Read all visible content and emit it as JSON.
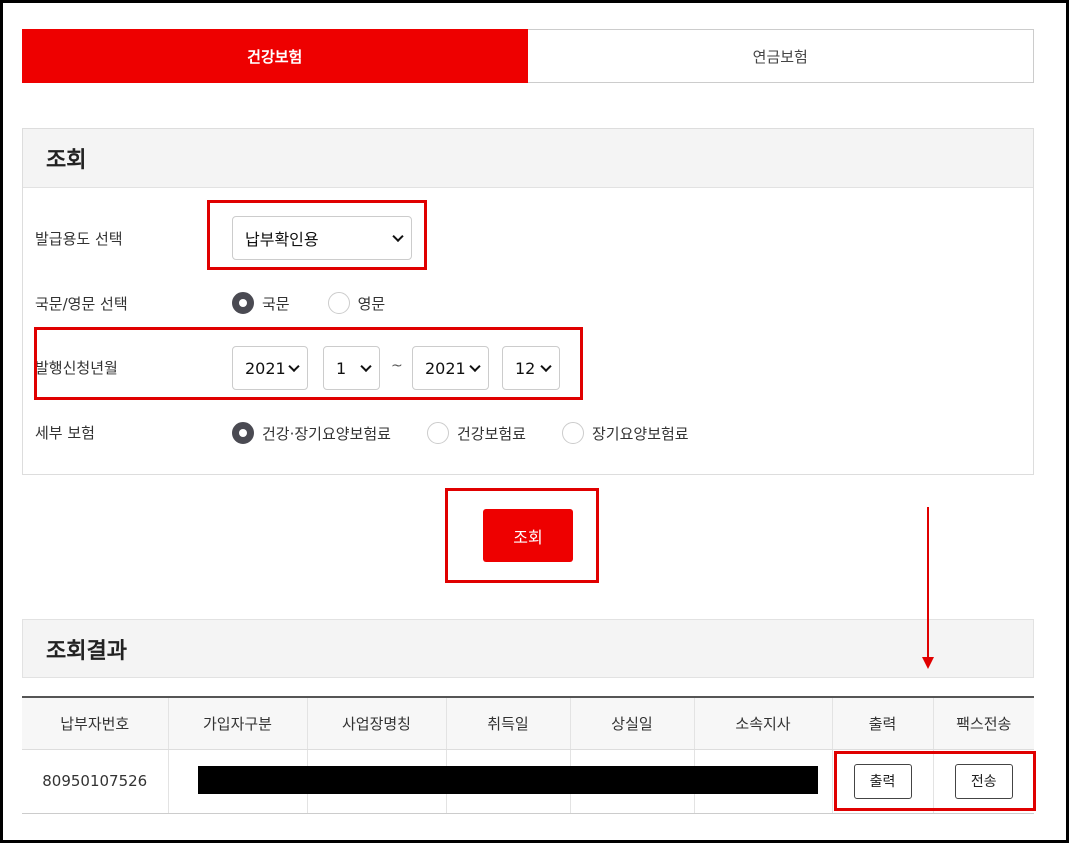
{
  "tabs": [
    {
      "label": "건강보험",
      "active": true
    },
    {
      "label": "연금보험",
      "active": false
    }
  ],
  "search": {
    "title": "조회",
    "purpose_label": "발급용도 선택",
    "purpose_value": "납부확인용",
    "language_label": "국문/영문 선택",
    "language_options": [
      {
        "label": "국문",
        "selected": true
      },
      {
        "label": "영문",
        "selected": false
      }
    ],
    "period_label": "발행신청년월",
    "period": {
      "from_year": "2021",
      "from_month": "1",
      "separator": "~",
      "to_year": "2021",
      "to_month": "12"
    },
    "detail_label": "세부 보험",
    "detail_options": [
      {
        "label": "건강·장기요양보험료",
        "selected": true
      },
      {
        "label": "건강보험료",
        "selected": false
      },
      {
        "label": "장기요양보험료",
        "selected": false
      }
    ],
    "submit_label": "조회"
  },
  "results": {
    "title": "조회결과",
    "columns": [
      "납부자번호",
      "가입자구분",
      "사업장명칭",
      "취득일",
      "상실일",
      "소속지사",
      "출력",
      "팩스전송"
    ],
    "rows": [
      {
        "payer_no": "80950107526",
        "print_label": "출력",
        "fax_label": "전송"
      }
    ]
  },
  "colors": {
    "accent": "#ee0000",
    "annotation": "#e00000",
    "radio_selected": "#4a4a52"
  }
}
